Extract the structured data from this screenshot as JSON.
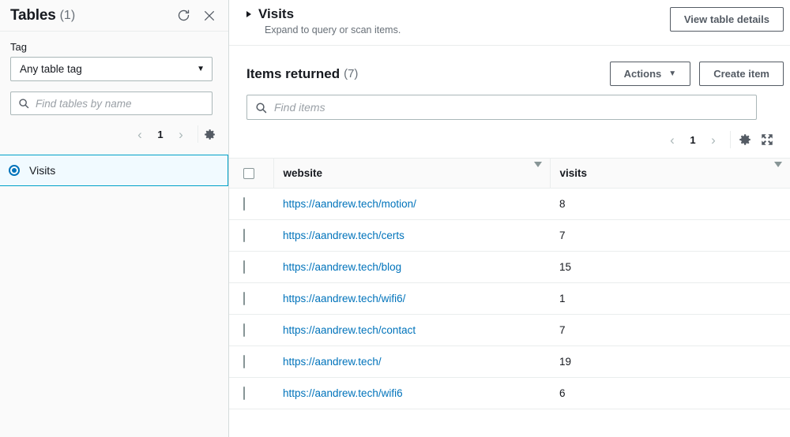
{
  "sidebar": {
    "title": "Tables",
    "count": "(1)",
    "refresh_icon": "refresh-icon",
    "close_icon": "close-icon",
    "tag_label": "Tag",
    "tag_value": "Any table tag",
    "tag_caret": "▼",
    "search_placeholder": "Find tables by name",
    "search_icon": "search-icon",
    "pagination": {
      "prev": "‹",
      "page": "1",
      "next": "›",
      "settings_icon": "gear-icon"
    },
    "items": [
      {
        "label": "Visits",
        "selected": true
      }
    ]
  },
  "main": {
    "table_header": {
      "expand_icon": "triangle-right-icon",
      "title": "Visits",
      "subtitle": "Expand to query or scan items.",
      "details_button": "View table details"
    },
    "items_section": {
      "title": "Items returned",
      "count": "(7)",
      "actions_button": "Actions",
      "actions_caret": "▼",
      "create_button": "Create item",
      "search_placeholder": "Find items",
      "search_icon": "search-icon"
    },
    "pagination": {
      "prev": "‹",
      "page": "1",
      "next": "›",
      "settings_icon": "gear-icon",
      "expand_icon": "fullscreen-expand-icon"
    },
    "table": {
      "columns": [
        {
          "key": "website",
          "label": "website",
          "sort_icon": "sort-descending-icon"
        },
        {
          "key": "visits",
          "label": "visits",
          "sort_icon": "sort-descending-icon"
        }
      ],
      "rows": [
        {
          "website": "https://aandrew.tech/motion/",
          "visits": "8"
        },
        {
          "website": "https://aandrew.tech/certs",
          "visits": "7"
        },
        {
          "website": "https://aandrew.tech/blog",
          "visits": "15"
        },
        {
          "website": "https://aandrew.tech/wifi6/",
          "visits": "1"
        },
        {
          "website": "https://aandrew.tech/contact",
          "visits": "7"
        },
        {
          "website": "https://aandrew.tech/",
          "visits": "19"
        },
        {
          "website": "https://aandrew.tech/wifi6",
          "visits": "6"
        }
      ]
    }
  },
  "colors": {
    "link": "#0073bb",
    "selected_border": "#00a1c9",
    "selected_bg": "#f1faff",
    "sidebar_bg": "#fafafa",
    "border": "#eaeded",
    "muted_text": "#687078"
  }
}
